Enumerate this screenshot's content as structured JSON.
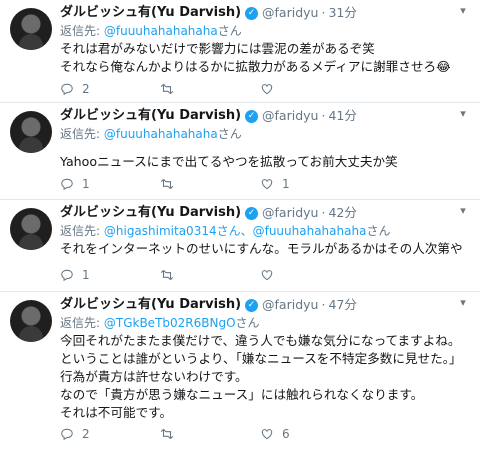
{
  "tweets": [
    {
      "name": "ダルビッシュ有(Yu Darvish)",
      "handle": "@faridyu",
      "time": "31分",
      "reply_label": "返信先:",
      "reply_mentions": "@fuuuhahahahaha",
      "reply_suffix": "さん",
      "lines": [
        "それは君がみないだけで影響力には雲泥の差があるぞ笑",
        "それなら俺なんかよりはるかに拡散力があるメディアに謝罪させろ😂"
      ],
      "replies": "2",
      "retweets": "",
      "likes": ""
    },
    {
      "name": "ダルビッシュ有(Yu Darvish)",
      "handle": "@faridyu",
      "time": "41分",
      "reply_label": "返信先:",
      "reply_mentions": "@fuuuhahahahaha",
      "reply_suffix": "さん",
      "lines": [
        "Yahooニュースにまで出てるやつを拡散ってお前大丈夫か笑"
      ],
      "replies": "1",
      "retweets": "",
      "likes": "1"
    },
    {
      "name": "ダルビッシュ有(Yu Darvish)",
      "handle": "@faridyu",
      "time": "42分",
      "reply_label": "返信先:",
      "reply_mentions": "@higashimita0314さん、@fuuuhahahahaha",
      "reply_suffix": "さん",
      "lines": [
        "それをインターネットのせいにすんな。モラルがあるかはその人次第や"
      ],
      "replies": "1",
      "retweets": "",
      "likes": ""
    },
    {
      "name": "ダルビッシュ有(Yu Darvish)",
      "handle": "@faridyu",
      "time": "47分",
      "reply_label": "返信先:",
      "reply_mentions": "@TGkBeTb02R6BNgO",
      "reply_suffix": "さん",
      "lines": [
        "今回それがたまたま僕だけで、違う人でも嫌な気分になってますよね。",
        "ということは誰がというより、「嫌なニュースを不特定多数に見せた。」",
        "行為が貴方は許せないわけです。",
        "なので「貴方が思う嫌なニュース」には触れられなくなります。",
        "それは不可能です。"
      ],
      "replies": "2",
      "retweets": "",
      "likes": "6"
    }
  ],
  "icons": {
    "reply": "reply-icon",
    "retweet": "retweet-icon",
    "like": "heart-icon",
    "menu": "chevron-down-icon",
    "verified": "verified-badge-icon"
  },
  "colors": {
    "accent": "#1da1f2",
    "muted": "#657786",
    "text": "#14171a"
  }
}
